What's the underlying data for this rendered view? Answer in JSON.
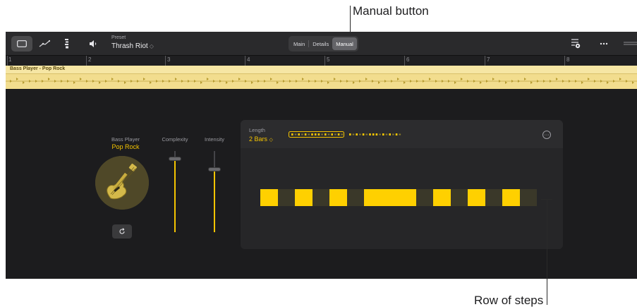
{
  "callouts": {
    "manual_button": "Manual button",
    "row_of_steps": "Row of steps"
  },
  "toolbar": {
    "tools": [
      {
        "icon": "region-view-icon",
        "active": true
      },
      {
        "icon": "curve-icon",
        "active": false
      },
      {
        "icon": "steps-icon",
        "active": false
      }
    ],
    "speaker_icon": "speaker-icon",
    "preset_label": "Preset",
    "preset_value": "Thrash Riot",
    "preset_chevron": "◇",
    "tabs": [
      {
        "label": "Main",
        "active": false
      },
      {
        "label": "Details",
        "active": false
      },
      {
        "label": "Manual",
        "active": true
      }
    ],
    "right_icons": [
      "sliders-gear-icon",
      "more-icon",
      "drag-handle-icon"
    ]
  },
  "ruler": {
    "bars": [
      "1",
      "2",
      "3",
      "4",
      "5",
      "6",
      "7",
      "8"
    ]
  },
  "region": {
    "title": "Bass Player - Pop Rock",
    "color": "#f2dd8e"
  },
  "player": {
    "label": "Bass Player",
    "style": "Pop Rock",
    "refresh_icon": "refresh-icon"
  },
  "sliders": [
    {
      "label": "Complexity",
      "value": 0.9
    },
    {
      "label": "Intensity",
      "value": 0.77
    }
  ],
  "pattern": {
    "length_label": "Length",
    "length_value": "2 Bars",
    "length_chevron": "◇",
    "more_icon": "ellipsis-circle-icon",
    "steps": [
      1,
      0,
      1,
      0,
      1,
      0,
      1,
      1,
      1,
      0,
      1,
      0,
      1,
      0,
      1,
      0
    ]
  },
  "colors": {
    "accent": "#f5c400",
    "step_on": "#ffd000",
    "background": "#1c1c1e"
  }
}
